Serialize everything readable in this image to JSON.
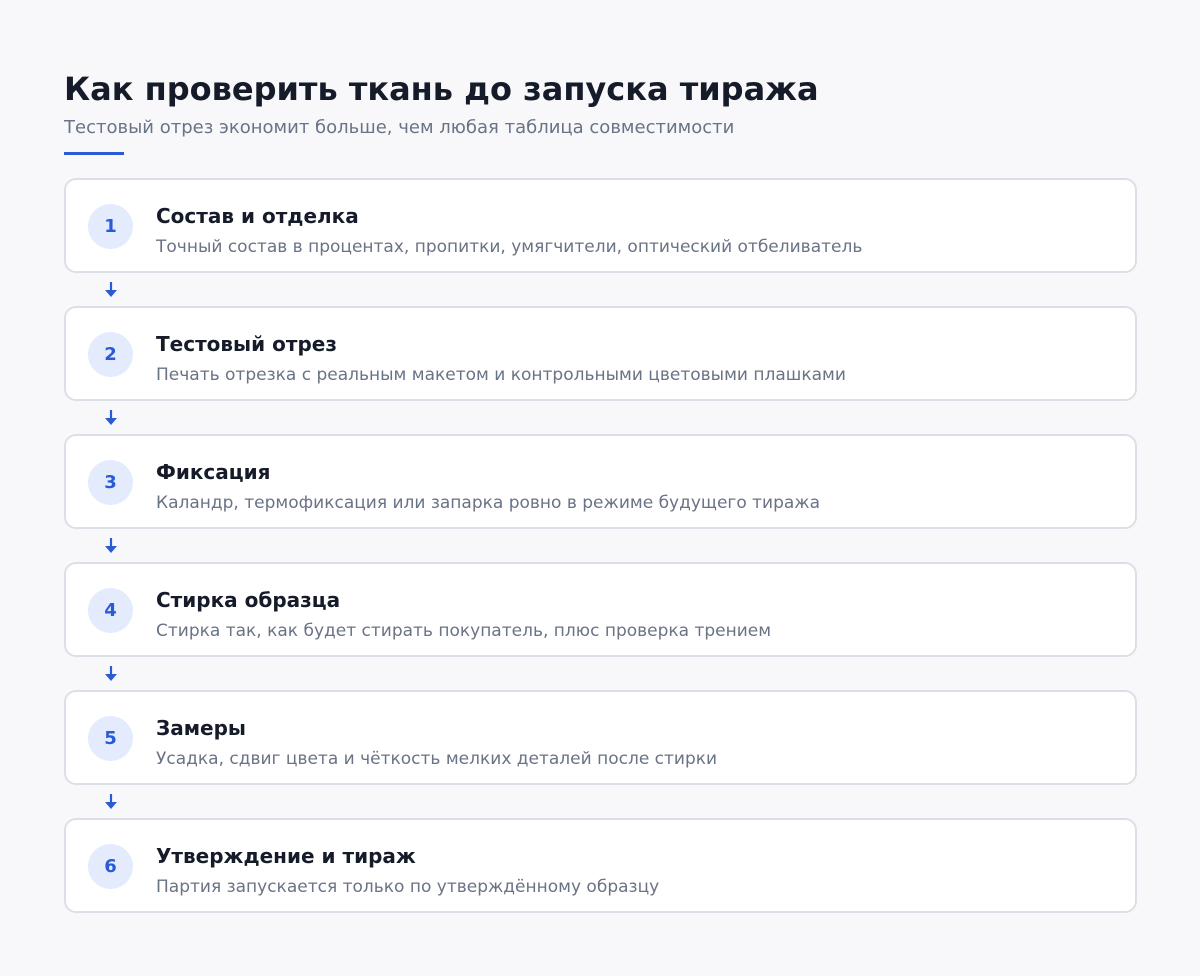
{
  "header": {
    "title": "Как проверить ткань до запуска тиража",
    "subtitle": "Тестовый отрез экономит больше, чем любая таблица совместимости"
  },
  "colors": {
    "accent": "#2a5bd7",
    "badge_background": "#e3ebfc",
    "card_border": "#dddfe8",
    "page_background": "#f8f8fb"
  },
  "connector_icon": "arrow-down-icon",
  "steps": [
    {
      "number": "1",
      "title": "Состав и отделка",
      "description": "Точный состав в процентах, пропитки, умягчители, оптический отбеливатель"
    },
    {
      "number": "2",
      "title": "Тестовый отрез",
      "description": "Печать отрезка с реальным макетом и контрольными цветовыми плашками"
    },
    {
      "number": "3",
      "title": "Фиксация",
      "description": "Каландр, термофиксация или запарка ровно в режиме будущего тиража"
    },
    {
      "number": "4",
      "title": "Стирка образца",
      "description": "Стирка так, как будет стирать покупатель, плюс проверка трением"
    },
    {
      "number": "5",
      "title": "Замеры",
      "description": "Усадка, сдвиг цвета и чёткость мелких деталей после стирки"
    },
    {
      "number": "6",
      "title": "Утверждение и тираж",
      "description": "Партия запускается только по утверждённому образцу"
    }
  ]
}
